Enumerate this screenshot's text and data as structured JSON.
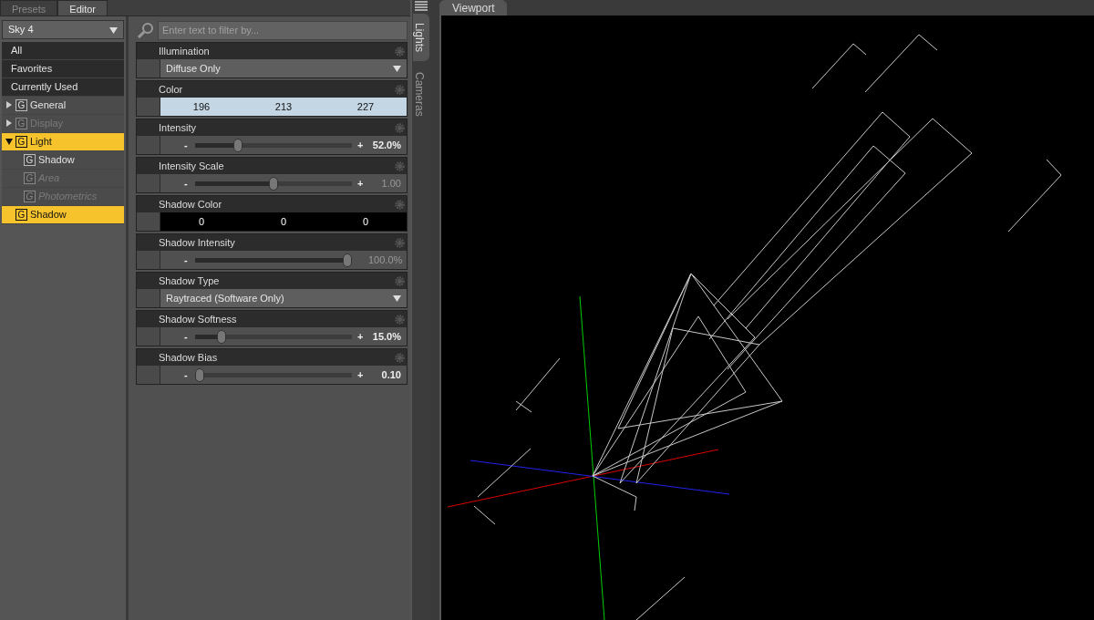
{
  "top_tabs": [
    {
      "label": "Presets",
      "selected": false
    },
    {
      "label": "Editor",
      "selected": true
    }
  ],
  "node_select": {
    "value": "Sky 4"
  },
  "tree": [
    {
      "kind": "filter",
      "label": "All"
    },
    {
      "kind": "filter",
      "label": "Favorites"
    },
    {
      "kind": "filter",
      "label": "Currently Used"
    },
    {
      "kind": "group",
      "badge": "G",
      "label": "General",
      "expanded": false,
      "disabled": false,
      "selected": false
    },
    {
      "kind": "group",
      "badge": "G",
      "label": "Display",
      "expanded": false,
      "disabled": true,
      "selected": false
    },
    {
      "kind": "group",
      "badge": "G",
      "label": "Light",
      "expanded": true,
      "disabled": false,
      "selected": true,
      "children": [
        {
          "kind": "group",
          "badge": "G",
          "label": "Shadow",
          "disabled": false,
          "selected": false
        },
        {
          "kind": "group",
          "badge": "G",
          "label": "Area",
          "disabled": true,
          "selected": false
        },
        {
          "kind": "group",
          "badge": "G",
          "label": "Photometrics",
          "disabled": true,
          "selected": false
        }
      ]
    },
    {
      "kind": "group",
      "badge": "G",
      "label": "Shadow",
      "disabled": false,
      "selected": true
    }
  ],
  "filter": {
    "placeholder": "Enter text to filter by..."
  },
  "properties": [
    {
      "kind": "dropdown",
      "label": "Illumination",
      "value": "Diffuse Only"
    },
    {
      "kind": "color",
      "label": "Color",
      "color": "#c4d5e3",
      "values": [
        "196",
        "213",
        "227"
      ]
    },
    {
      "kind": "slider",
      "label": "Intensity",
      "decrement": "-",
      "increment": "+",
      "level": 0.26,
      "reading": "52.0%",
      "modified": true
    },
    {
      "kind": "slider",
      "label": "Intensity Scale",
      "decrement": "-",
      "increment": "+",
      "level": 0.5,
      "reading": "1.00",
      "modified": false
    },
    {
      "kind": "color",
      "label": "Shadow Color",
      "color": "#000000",
      "values": [
        "0",
        "0",
        "0"
      ]
    },
    {
      "kind": "slider",
      "label": "Shadow Intensity",
      "decrement": "-",
      "level": 1,
      "reading": "100.0%",
      "modified": false
    },
    {
      "kind": "dropdown",
      "label": "Shadow Type",
      "value": "Raytraced (Software Only)"
    },
    {
      "kind": "slider",
      "label": "Shadow Softness",
      "decrement": "-",
      "increment": "+",
      "level": 0.15,
      "reading": "15.0%",
      "modified": true
    },
    {
      "kind": "slider",
      "label": "Shadow Bias",
      "decrement": "-",
      "increment": "+",
      "level": 0,
      "reading": "0.10",
      "modified": true
    }
  ],
  "side_tabs": [
    {
      "label": "Lights",
      "selected": true
    },
    {
      "label": "Cameras",
      "selected": false
    }
  ],
  "viewport": {
    "title": "Viewport"
  }
}
